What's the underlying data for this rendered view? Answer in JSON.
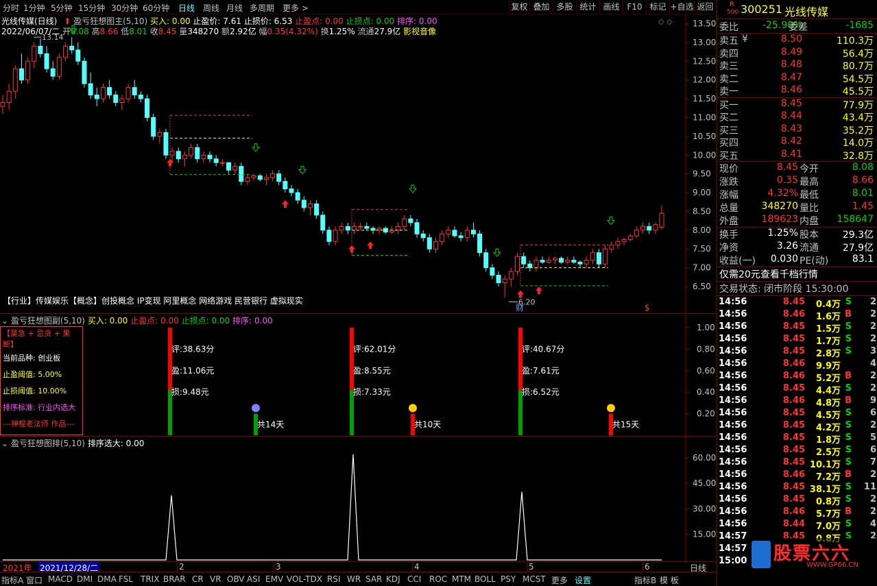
{
  "topbar": {
    "periods": [
      "分时",
      "1分钟",
      "5分钟",
      "15分钟",
      "30分钟",
      "60分钟",
      "日线",
      "周线",
      "月线",
      "多周期",
      "更多 >"
    ],
    "active": "日线",
    "buttons": [
      "复权",
      "叠加",
      "多股",
      "统计",
      "画线",
      "F10",
      "标记",
      "+自选",
      "返回"
    ]
  },
  "main": {
    "title": "光线传媒(日线)",
    "indicator": "盈亏狂想图主(5,10)",
    "buy": "买入: 0.00",
    "tp": "止盈价: 7.61",
    "sl": "止损价: 6.53",
    "tp_pt": "止盈点: 0.00",
    "sl_pt": "止损点: 0.00",
    "sort": "排序: 0.00",
    "date": "2022/06/07/二",
    "open_lbl": "开",
    "open": "8.08",
    "high_lbl": "高",
    "high": "8.66",
    "low_lbl": "低",
    "low": "8.01",
    "close_lbl": "收",
    "close": "8.45",
    "vol_lbl": "量",
    "vol": "348270",
    "amt_lbl": "额",
    "amt": "2.92亿",
    "chg_lbl": "幅",
    "chg": "0.35(4.32%)",
    "turn_lbl": "换",
    "turn": "1.25%",
    "float_lbl": "流通",
    "float": "27.9亿",
    "sector": "影视音像",
    "max_label": "13.14",
    "min_label": "6.20",
    "industry_line": "【行业】传媒娱乐【概念】创投概念 IP变现 阿里概念 网络游戏 民营银行 虚拟现实",
    "cai": "财",
    "dollar": "$",
    "yaxis": [
      "13.50",
      "13.00",
      "12.50",
      "12.00",
      "11.50",
      "11.00",
      "10.50",
      "10.00",
      "9.50",
      "9.00",
      "8.50",
      "8.00",
      "7.50",
      "7.00",
      "6.50"
    ]
  },
  "sub1": {
    "title": "盈亏狂想图副(5,10)",
    "buy": "买入: 0.00",
    "tp_pt": "止盈点: 0.00",
    "sl_pt": "止损点: 0.00",
    "sort": "排序: 0.00",
    "box_title": "【莫急 + 忌贪 + 果断】",
    "box_lines": [
      "当前品种:  创业板",
      "止盈阈值:  5.00%",
      "止损阈值:  10.00%",
      "排序标准:  行业内选大",
      "---神棍老法师 作品---"
    ],
    "trades": [
      {
        "score": "评:38.63分",
        "profit": "盈:11.06元",
        "loss": "损:9.48元",
        "days": "共14天"
      },
      {
        "score": "评:62.01分",
        "profit": "盈:8.55元",
        "loss": "损:7.33元",
        "days": "共10天"
      },
      {
        "score": "评:40.67分",
        "profit": "盈:7.61元",
        "loss": "损:6.52元",
        "days": "共15天"
      }
    ],
    "yaxis": [
      "1.00",
      "0.80",
      "0.60",
      "0.40",
      "0.20"
    ]
  },
  "sub2": {
    "title": "盈亏狂想图排(5,10)",
    "sort": "排序选大: 0.00",
    "yaxis": [
      "60.00",
      "45.00",
      "30.00",
      "15.00"
    ],
    "peaks": [
      38,
      62,
      40
    ]
  },
  "xaxis": {
    "year": "2021年",
    "date": "2021/12/28/二",
    "months": [
      "2",
      "3",
      "4",
      "5",
      "6"
    ],
    "period": "日线"
  },
  "bottombar": [
    "指标A",
    "窗口",
    "MACD",
    "DMI",
    "DMA",
    "FSL",
    "TRIX",
    "BRAR",
    "CR",
    "VR",
    "OBV",
    "ASI",
    "EMV",
    "VOL-TDX",
    "RSI",
    "WR",
    "SAR",
    "KDJ",
    "CCI",
    "ROC",
    "MTM",
    "BOLL",
    "PSY",
    "MCST",
    "更多",
    "设置",
    "指标B",
    "模 板"
  ],
  "stock": {
    "r_label": "R",
    "r_sub": "500",
    "code": "300251",
    "name": "光线传媒",
    "wb_lbl": "委比",
    "wb": "-25.90%",
    "wc_lbl": "委差",
    "wc": "-1685",
    "sells": [
      {
        "l": "卖五",
        "p": "8.50",
        "v": "110.3万"
      },
      {
        "l": "卖四",
        "p": "8.49",
        "v": "56.4万"
      },
      {
        "l": "卖三",
        "p": "8.48",
        "v": "80.7万"
      },
      {
        "l": "卖二",
        "p": "8.47",
        "v": "54.5万"
      },
      {
        "l": "卖一",
        "p": "8.46",
        "v": "45.5万"
      }
    ],
    "buys": [
      {
        "l": "买一",
        "p": "8.45",
        "v": "77.9万"
      },
      {
        "l": "买二",
        "p": "8.44",
        "v": "43.4万"
      },
      {
        "l": "买三",
        "p": "8.43",
        "v": "35.2万"
      },
      {
        "l": "买四",
        "p": "8.42",
        "v": "14.0万"
      },
      {
        "l": "买五",
        "p": "8.41",
        "v": "32.8万"
      }
    ],
    "yen": "¥",
    "quotes": [
      {
        "l1": "现价",
        "v1": "8.45",
        "l2": "今开",
        "v2": "8.08",
        "c1": "red",
        "c2": "green"
      },
      {
        "l1": "涨跌",
        "v1": "0.35",
        "l2": "最高",
        "v2": "8.66",
        "c1": "red",
        "c2": "red"
      },
      {
        "l1": "涨幅",
        "v1": "4.32%",
        "l2": "最低",
        "v2": "8.01",
        "c1": "red",
        "c2": "green"
      },
      {
        "l1": "总量",
        "v1": "348270",
        "l2": "量比",
        "v2": "1.45",
        "c1": "yellow",
        "c2": "red"
      },
      {
        "l1": "外盘",
        "v1": "189623",
        "l2": "内盘",
        "v2": "158647",
        "c1": "red",
        "c2": "green"
      }
    ],
    "quotes2": [
      {
        "l1": "换手",
        "v1": "1.25%",
        "l2": "股本",
        "v2": "29.3亿"
      },
      {
        "l1": "净资",
        "v1": "3.26",
        "l2": "流通",
        "v2": "27.9亿"
      },
      {
        "l1": "收益(一)",
        "v1": "0.030",
        "l2": "PE(动)",
        "v2": "83.1"
      }
    ],
    "promo": "仅需20元查看千档行情",
    "status": "交易状态: 闭市阶段 15:30:00",
    "ticks": [
      {
        "t": "14:56",
        "p": "8.45",
        "v": "0.4万",
        "s": "S",
        "n": "2"
      },
      {
        "t": "14:56",
        "p": "8.46",
        "v": "1.6万",
        "s": "B",
        "n": "2"
      },
      {
        "t": "14:56",
        "p": "8.45",
        "v": "1.5万",
        "s": "S",
        "n": "2"
      },
      {
        "t": "14:56",
        "p": "8.45",
        "v": "1.7万",
        "s": "S",
        "n": "2"
      },
      {
        "t": "14:56",
        "p": "8.45",
        "v": "2.8万",
        "s": "S",
        "n": "3"
      },
      {
        "t": "14:56",
        "p": "8.46",
        "v": "9.9万",
        "s": "",
        "n": "4"
      },
      {
        "t": "14:56",
        "p": "8.46",
        "v": "5.2万",
        "s": "B",
        "n": "2"
      },
      {
        "t": "14:56",
        "p": "8.45",
        "v": "4.4万",
        "s": "S",
        "n": "2"
      },
      {
        "t": "14:56",
        "p": "8.46",
        "v": "4.8万",
        "s": "B",
        "n": "9"
      },
      {
        "t": "14:56",
        "p": "8.45",
        "v": "4.5万",
        "s": "S",
        "n": "6"
      },
      {
        "t": "14:56",
        "p": "8.45",
        "v": "4.2万",
        "s": "S",
        "n": "2"
      },
      {
        "t": "14:56",
        "p": "8.45",
        "v": "1.8万",
        "s": "S",
        "n": "5"
      },
      {
        "t": "14:56",
        "p": "8.45",
        "v": "2.5万",
        "s": "S",
        "n": "6"
      },
      {
        "t": "14:56",
        "p": "8.45",
        "v": "10.1万",
        "s": "S",
        "n": "7"
      },
      {
        "t": "14:56",
        "p": "8.46",
        "v": "7.2万",
        "s": "B",
        "n": "2"
      },
      {
        "t": "14:56",
        "p": "8.45",
        "v": "38.1万",
        "s": "S",
        "n": "11"
      },
      {
        "t": "14:56",
        "p": "8.45",
        "v": "0.8万",
        "s": "S",
        "n": "2"
      },
      {
        "t": "14:56",
        "p": "8.46",
        "v": "5.7万",
        "s": "B",
        "n": "2"
      },
      {
        "t": "14:56",
        "p": "8.44",
        "v": "7.0万",
        "s": "S",
        "n": "4"
      },
      {
        "t": "14:57",
        "p": "8.45",
        "v": "0.8万",
        "s": "S",
        "n": "2"
      },
      {
        "t": "14:57",
        "p": "8.45",
        "v": "",
        "s": "",
        "n": ""
      },
      {
        "t": "15:00",
        "p": "",
        "v": "",
        "s": "",
        "n": ""
      }
    ],
    "watermark": "股票六六",
    "watermark_url": "WWW.GP66.CN"
  },
  "colors": {
    "up": "#ff3232",
    "down": "#54ffff",
    "grid": "#800000"
  },
  "chart_data": {
    "type": "candlestick",
    "ylim": [
      6.3,
      13.6
    ],
    "candles": [
      [
        11.3,
        11.6,
        11.1,
        11.4
      ],
      [
        11.4,
        11.9,
        11.2,
        11.7
      ],
      [
        11.7,
        12.4,
        11.5,
        12.3
      ],
      [
        12.3,
        12.7,
        11.9,
        12.0
      ],
      [
        12.0,
        12.6,
        11.9,
        12.5
      ],
      [
        12.5,
        13.0,
        12.3,
        12.9
      ],
      [
        12.9,
        13.1,
        12.6,
        12.7
      ],
      [
        12.7,
        12.9,
        12.2,
        12.3
      ],
      [
        12.3,
        12.5,
        12.0,
        12.1
      ],
      [
        12.1,
        12.7,
        12.0,
        12.6
      ],
      [
        12.6,
        13.0,
        12.5,
        12.9
      ],
      [
        12.9,
        13.14,
        12.7,
        12.8
      ],
      [
        12.8,
        13.0,
        12.4,
        12.5
      ],
      [
        12.5,
        12.6,
        11.8,
        11.9
      ],
      [
        11.9,
        12.2,
        11.5,
        11.6
      ],
      [
        11.6,
        11.8,
        11.3,
        11.5
      ],
      [
        11.5,
        11.9,
        11.4,
        11.8
      ],
      [
        11.8,
        12.0,
        11.5,
        11.6
      ],
      [
        11.6,
        11.7,
        11.3,
        11.4
      ],
      [
        11.4,
        11.6,
        11.2,
        11.5
      ],
      [
        11.5,
        11.9,
        11.4,
        11.8
      ],
      [
        11.8,
        12.0,
        11.5,
        11.6
      ],
      [
        11.6,
        11.7,
        11.4,
        11.5
      ],
      [
        11.5,
        11.6,
        10.9,
        11.0
      ],
      [
        11.0,
        11.1,
        10.4,
        10.5
      ],
      [
        10.5,
        10.7,
        10.3,
        10.6
      ],
      [
        10.6,
        10.7,
        9.9,
        10.0
      ],
      [
        10.0,
        10.2,
        9.8,
        10.1
      ],
      [
        10.1,
        10.2,
        9.8,
        9.9
      ],
      [
        9.9,
        10.1,
        9.7,
        10.0
      ],
      [
        10.0,
        10.3,
        9.9,
        10.2
      ],
      [
        10.2,
        10.3,
        9.8,
        9.9
      ],
      [
        9.9,
        10.1,
        9.8,
        10.0
      ],
      [
        10.0,
        10.1,
        9.8,
        9.9
      ],
      [
        9.9,
        10.0,
        9.7,
        9.8
      ],
      [
        9.8,
        9.9,
        9.7,
        9.8
      ],
      [
        9.8,
        9.8,
        9.5,
        9.6
      ],
      [
        9.6,
        9.8,
        9.5,
        9.7
      ],
      [
        9.7,
        9.8,
        9.2,
        9.3
      ],
      [
        9.3,
        9.5,
        9.2,
        9.4
      ],
      [
        9.4,
        9.5,
        9.3,
        9.45
      ],
      [
        9.45,
        9.5,
        9.3,
        9.35
      ],
      [
        9.35,
        9.5,
        9.2,
        9.4
      ],
      [
        9.4,
        9.6,
        9.3,
        9.5
      ],
      [
        9.5,
        9.6,
        9.2,
        9.3
      ],
      [
        9.3,
        9.4,
        9.0,
        9.1
      ],
      [
        9.1,
        9.2,
        8.9,
        9.0
      ],
      [
        9.0,
        9.1,
        8.7,
        8.8
      ],
      [
        8.8,
        8.9,
        8.5,
        8.6
      ],
      [
        8.6,
        8.8,
        8.4,
        8.7
      ],
      [
        8.7,
        8.8,
        8.3,
        8.4
      ],
      [
        8.4,
        8.5,
        7.9,
        8.0
      ],
      [
        8.0,
        8.1,
        7.6,
        7.7
      ],
      [
        7.7,
        8.1,
        7.6,
        8.0
      ],
      [
        8.0,
        8.2,
        7.9,
        8.1
      ],
      [
        8.1,
        8.2,
        7.9,
        8.0
      ],
      [
        8.0,
        8.2,
        7.9,
        8.1
      ],
      [
        8.1,
        8.2,
        8.0,
        8.1
      ],
      [
        8.1,
        8.2,
        8.0,
        8.05
      ],
      [
        8.05,
        8.1,
        7.9,
        8.0
      ],
      [
        8.0,
        8.1,
        7.9,
        8.05
      ],
      [
        8.05,
        8.1,
        7.9,
        7.95
      ],
      [
        7.95,
        8.1,
        7.9,
        8.0
      ],
      [
        8.0,
        8.2,
        7.9,
        8.1
      ],
      [
        8.1,
        8.4,
        8.0,
        8.3
      ],
      [
        8.3,
        8.4,
        8.1,
        8.2
      ],
      [
        8.2,
        8.3,
        7.8,
        7.9
      ],
      [
        7.9,
        8.0,
        7.7,
        7.8
      ],
      [
        7.8,
        7.9,
        7.4,
        7.5
      ],
      [
        7.5,
        7.8,
        7.4,
        7.7
      ],
      [
        7.7,
        8.0,
        7.6,
        7.9
      ],
      [
        7.9,
        8.1,
        7.8,
        8.0
      ],
      [
        8.0,
        8.1,
        7.8,
        7.85
      ],
      [
        7.85,
        7.95,
        7.7,
        7.8
      ],
      [
        7.8,
        8.1,
        7.7,
        8.0
      ],
      [
        8.0,
        8.2,
        7.8,
        7.9
      ],
      [
        7.9,
        8.0,
        7.3,
        7.4
      ],
      [
        7.4,
        7.5,
        6.9,
        7.0
      ],
      [
        7.0,
        7.1,
        6.7,
        6.8
      ],
      [
        6.8,
        6.9,
        6.5,
        6.6
      ],
      [
        6.6,
        6.8,
        6.2,
        6.7
      ],
      [
        6.7,
        7.0,
        6.5,
        6.9
      ],
      [
        6.9,
        7.4,
        6.8,
        7.3
      ],
      [
        7.3,
        7.4,
        7.0,
        7.1
      ],
      [
        7.1,
        7.2,
        6.9,
        7.0
      ],
      [
        7.0,
        7.3,
        6.9,
        7.2
      ],
      [
        7.2,
        7.3,
        7.1,
        7.15
      ],
      [
        7.15,
        7.3,
        7.1,
        7.2
      ],
      [
        7.2,
        7.3,
        7.1,
        7.25
      ],
      [
        7.25,
        7.3,
        7.1,
        7.15
      ],
      [
        7.15,
        7.3,
        7.1,
        7.2
      ],
      [
        7.2,
        7.3,
        7.1,
        7.15
      ],
      [
        7.15,
        7.2,
        7.0,
        7.1
      ],
      [
        7.1,
        7.3,
        7.0,
        7.2
      ],
      [
        7.2,
        7.5,
        7.1,
        7.4
      ],
      [
        7.4,
        7.5,
        7.0,
        7.1
      ],
      [
        7.1,
        7.6,
        7.0,
        7.5
      ],
      [
        7.5,
        7.7,
        7.4,
        7.6
      ],
      [
        7.6,
        7.8,
        7.5,
        7.7
      ],
      [
        7.7,
        7.8,
        7.6,
        7.75
      ],
      [
        7.75,
        7.9,
        7.7,
        7.85
      ],
      [
        7.85,
        8.1,
        7.8,
        8.0
      ],
      [
        8.0,
        8.2,
        7.9,
        8.1
      ],
      [
        8.1,
        8.2,
        7.9,
        8.0
      ],
      [
        8.0,
        8.2,
        7.9,
        8.15
      ],
      [
        8.08,
        8.66,
        8.01,
        8.45
      ]
    ]
  }
}
